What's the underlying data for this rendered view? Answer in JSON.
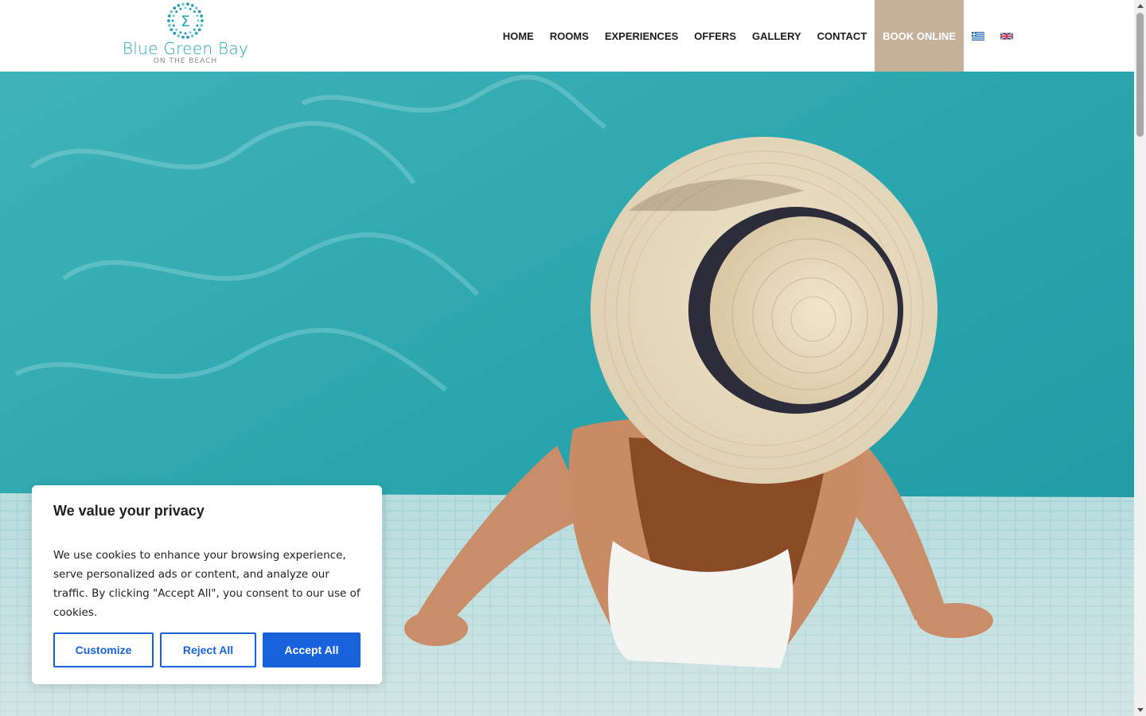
{
  "brand": {
    "name": "Blue Green Bay",
    "tagline": "ON THE BEACH",
    "logo_icon": "sigma-sun-logo-icon"
  },
  "nav": {
    "items": [
      {
        "label": "HOME"
      },
      {
        "label": "ROOMS"
      },
      {
        "label": "EXPERIENCES"
      },
      {
        "label": "OFFERS"
      },
      {
        "label": "GALLERY"
      },
      {
        "label": "CONTACT"
      },
      {
        "label": "BOOK ONLINE"
      }
    ],
    "languages": [
      {
        "icon": "greek-flag-icon"
      },
      {
        "icon": "uk-flag-icon"
      }
    ]
  },
  "hero": {
    "image": "woman-in-straw-hat-by-pool"
  },
  "cookie_banner": {
    "title": "We value your privacy",
    "text": "We use cookies to enhance your browsing experience, serve personalized ads or content, and analyze our traffic. By clicking \"Accept All\", you consent to our use of cookies.",
    "customize_label": "Customize",
    "reject_label": "Reject All",
    "accept_label": "Accept All"
  },
  "colors": {
    "brand_teal": "#1eaab7",
    "book_online_bg": "#c5b09a",
    "cookie_accent": "#1863dc"
  }
}
